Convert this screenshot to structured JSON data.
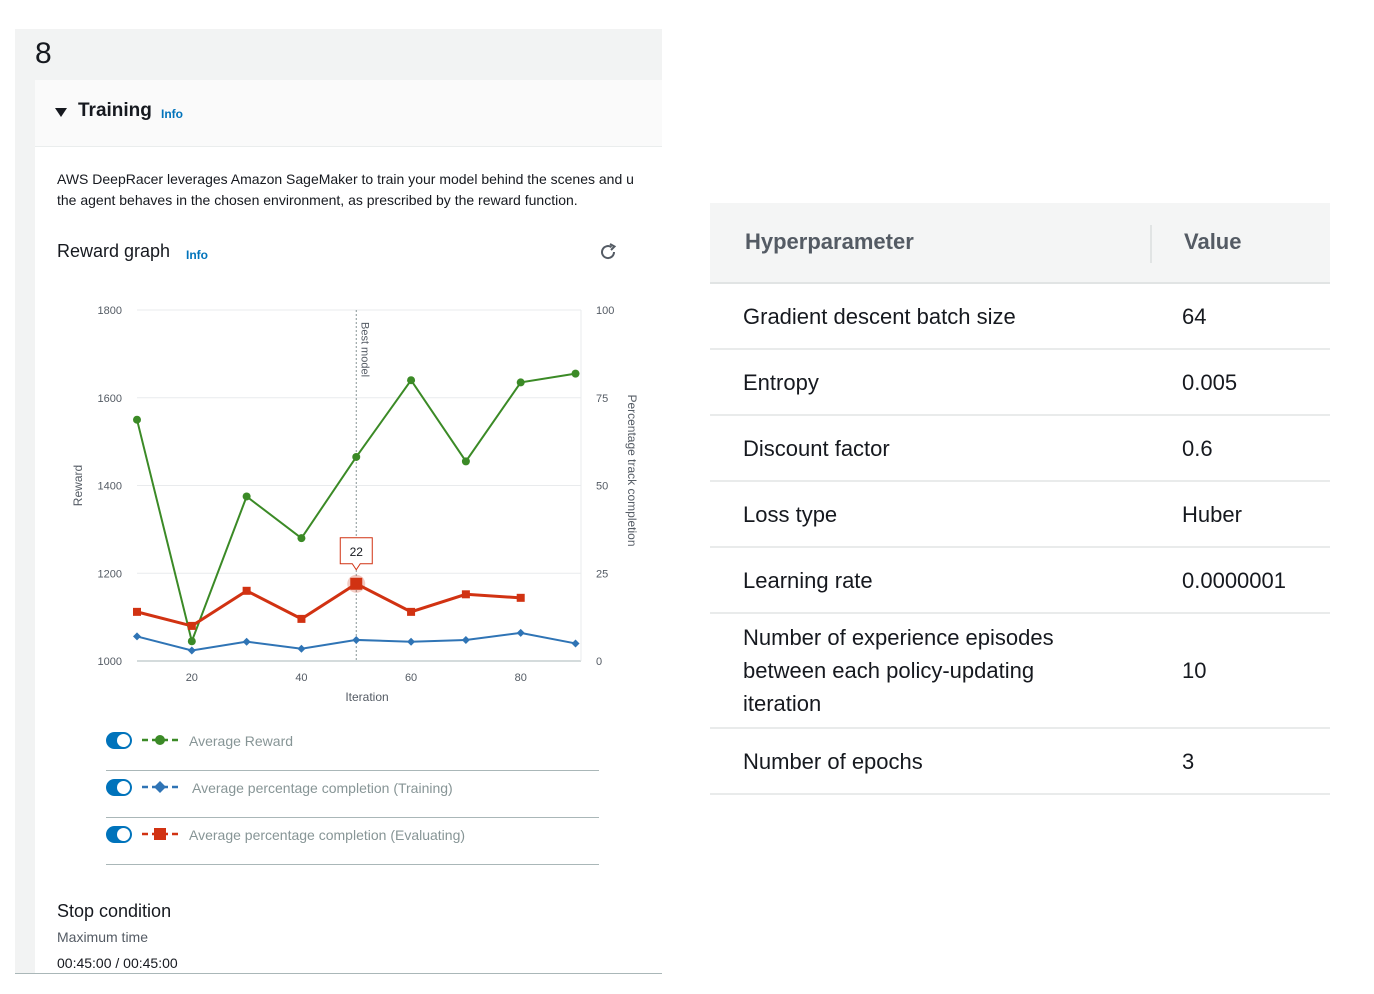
{
  "step_number": "8",
  "section": {
    "title": "Training",
    "info": "Info",
    "description_line1": "AWS DeepRacer leverages Amazon SageMaker to train your model behind the scenes and u",
    "description_line2": "the agent behaves in the chosen environment, as prescribed by the reward function."
  },
  "reward_graph": {
    "title": "Reward graph",
    "info": "Info",
    "refresh_icon": "refresh-icon"
  },
  "chart_data": {
    "type": "line",
    "x": [
      10,
      20,
      30,
      40,
      50,
      60,
      70,
      80,
      90
    ],
    "xlabel": "Iteration",
    "ylabel_left": "Reward",
    "ylabel_right": "Percentage track completion",
    "ylim_left": [
      1000,
      1800
    ],
    "ylim_right": [
      0,
      100
    ],
    "x_ticks": [
      20,
      40,
      60,
      80
    ],
    "y_ticks_left": [
      1000,
      1200,
      1400,
      1600,
      1800
    ],
    "y_ticks_right": [
      0,
      25,
      50,
      75,
      100
    ],
    "grid": true,
    "best_model_x": 50,
    "best_model_label": "Best model",
    "tooltip": {
      "x": 50,
      "text": "22"
    },
    "series": [
      {
        "name": "Average Reward",
        "axis": "left",
        "color": "#3b8a26",
        "marker": "circle",
        "x": [
          10,
          20,
          30,
          40,
          50,
          60,
          70,
          80,
          90
        ],
        "values": [
          1550,
          1045,
          1375,
          1280,
          1465,
          1640,
          1455,
          1635,
          1655
        ]
      },
      {
        "name": "Average percentage completion (Training)",
        "axis": "right",
        "color": "#2f74b5",
        "marker": "diamond",
        "x": [
          10,
          20,
          30,
          40,
          50,
          60,
          70,
          80,
          90
        ],
        "values": [
          7,
          3,
          5.5,
          3.5,
          6,
          5.5,
          6,
          8,
          5
        ]
      },
      {
        "name": "Average percentage completion (Evaluating)",
        "axis": "right",
        "color": "#d13212",
        "marker": "square",
        "x": [
          10,
          20,
          30,
          40,
          50,
          60,
          70,
          80
        ],
        "values": [
          14,
          10,
          20,
          12,
          22,
          14,
          19,
          18
        ]
      }
    ]
  },
  "legend": [
    {
      "label": "Average Reward",
      "color": "#3b8a26",
      "marker": "circle"
    },
    {
      "label": "Average percentage completion (Training)",
      "color": "#2f74b5",
      "marker": "diamond"
    },
    {
      "label": "Average percentage completion (Evaluating)",
      "color": "#d13212",
      "marker": "square"
    }
  ],
  "stop_condition": {
    "title": "Stop condition",
    "subtitle": "Maximum time",
    "value": "00:45:00 / 00:45:00"
  },
  "hyperparameters": {
    "header_param": "Hyperparameter",
    "header_value": "Value",
    "rows": [
      {
        "param": "Gradient descent batch size",
        "value": "64"
      },
      {
        "param": "Entropy",
        "value": "0.005"
      },
      {
        "param": "Discount factor",
        "value": "0.6"
      },
      {
        "param": "Loss type",
        "value": "Huber"
      },
      {
        "param": "Learning rate",
        "value": "0.0000001"
      },
      {
        "param": "Number of experience episodes between each policy-updating iteration",
        "value": "10"
      },
      {
        "param": "Number of epochs",
        "value": "3"
      }
    ]
  }
}
